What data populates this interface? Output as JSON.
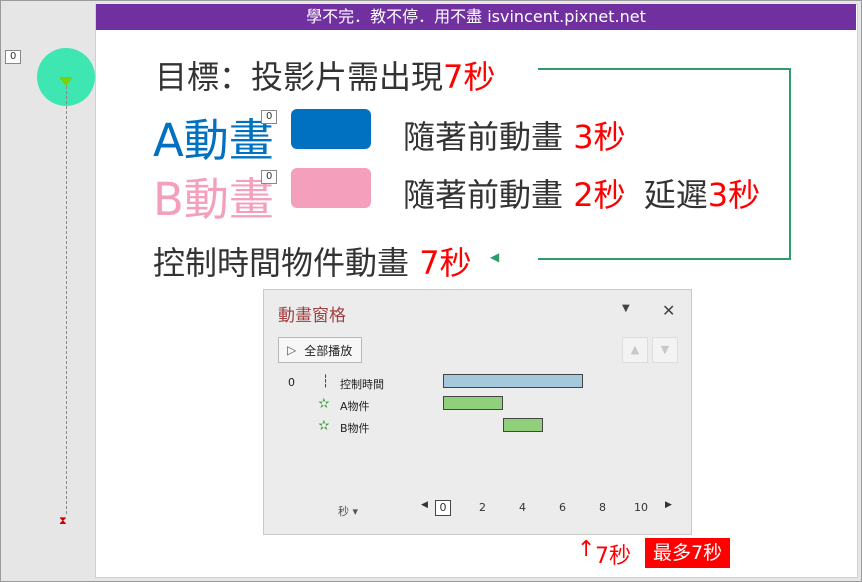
{
  "banner": "學不完．教不停．用不盡 isvincent.pixnet.net",
  "left_tag": "0",
  "goal": {
    "label": "目標：投影片需出現",
    "value": "7秒"
  },
  "row_a": {
    "name": "A動畫",
    "tag": "0",
    "text": "隨著前動畫",
    "value": "3秒",
    "color": "#0070c0"
  },
  "row_b": {
    "name": "B動畫",
    "tag": "0",
    "text": "隨著前動畫",
    "value": "2秒",
    "delay_label": "延遲",
    "delay_value": "3秒",
    "color": "#f4a0bd"
  },
  "control": {
    "text": "控制時間物件動畫",
    "value": "7秒"
  },
  "pane": {
    "title": "動畫窗格",
    "dropdown_icon": "chevron-down-icon",
    "close_icon": "close-icon",
    "play_all": "全部播放",
    "rows": [
      {
        "index": "0",
        "icon": "motion-path-icon",
        "label": "控制時間",
        "start": 0,
        "end": 7,
        "color": "#a5c8dc"
      },
      {
        "index": "",
        "icon": "star-effect-icon",
        "label": "A物件",
        "start": 0,
        "end": 3,
        "color": "#90d07a"
      },
      {
        "index": "",
        "icon": "star-effect-icon",
        "label": "B物件",
        "start": 3,
        "end": 5,
        "color": "#90d07a"
      }
    ],
    "seconds_label": "秒",
    "timeline_ticks": [
      "0",
      "2",
      "4",
      "6",
      "8",
      "10"
    ]
  },
  "bottom": {
    "value": "7秒",
    "most": "最多7秒"
  }
}
